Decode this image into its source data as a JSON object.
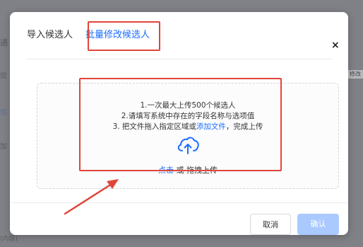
{
  "background": {
    "fragments": [
      "通",
      "信",
      "信",
      "加",
      "(内容)"
    ],
    "pill_label": "修改"
  },
  "modal": {
    "tabs": [
      {
        "label": "导入候选人",
        "active": false
      },
      {
        "label": "批量修改候选人",
        "active": true
      }
    ],
    "close_glyph": "×",
    "upload": {
      "line1": "1.一次最大上传500个候选人",
      "line2": "2.请填写系统中存在的字段名称与选项值",
      "line3_prefix": "3. 把文件拖入指定区域或",
      "line3_link": "添加文件",
      "line3_suffix": "，完成上传",
      "action_link": "点击",
      "action_text": " 或 拖拽上传",
      "icon": "cloud-upload-icon"
    },
    "buttons": {
      "cancel": "取消",
      "confirm": "确认"
    }
  },
  "colors": {
    "accent": "#1a6dff",
    "annotation": "#e0453a",
    "confirm_disabled": "#a9c9ff"
  }
}
